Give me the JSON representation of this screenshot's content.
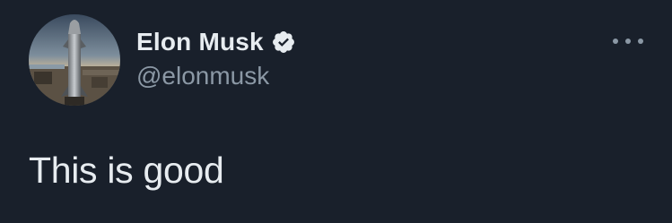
{
  "tweet": {
    "author": {
      "display_name": "Elon Musk",
      "handle": "@elonmusk",
      "verified": true,
      "avatar_icon": "starship-rocket-avatar"
    },
    "more_icon": "more-horizontal-icon",
    "text": "This is good"
  },
  "colors": {
    "background": "#19202b",
    "primary_text": "#e7ecf0",
    "secondary_text": "#8b98a5"
  }
}
